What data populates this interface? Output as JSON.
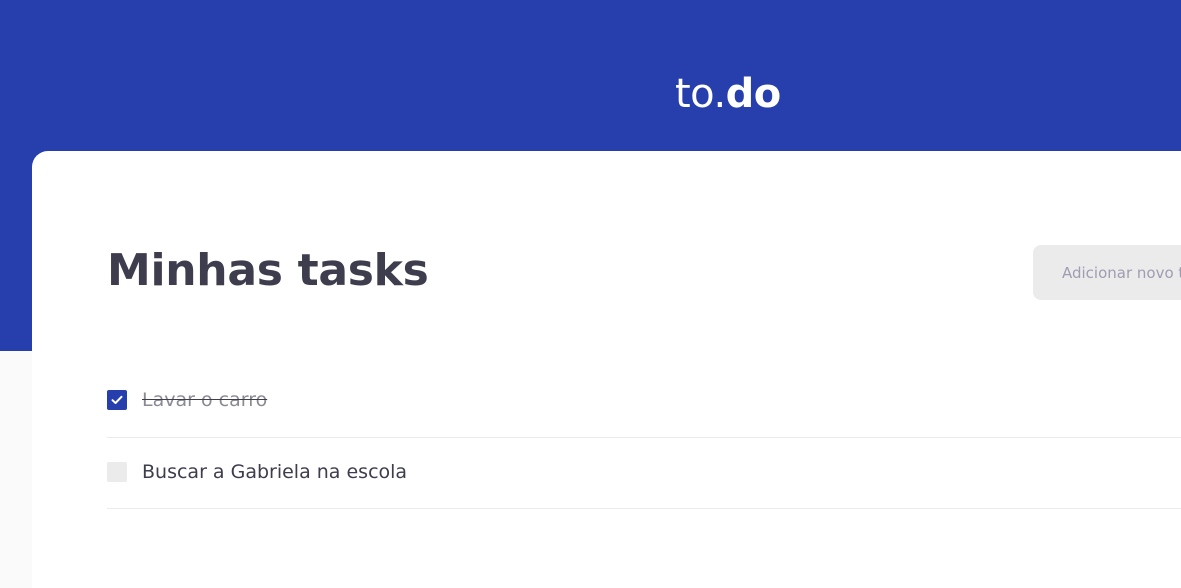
{
  "app": {
    "logo_light": "to.",
    "logo_bold": "do"
  },
  "main": {
    "title": "Minhas tasks",
    "new_task": {
      "placeholder": "Adicionar novo todo",
      "value": ""
    },
    "tasks": [
      {
        "title": "Lavar o carro",
        "completed": true
      },
      {
        "title": "Buscar a Gabriela na escola",
        "completed": false
      }
    ]
  },
  "colors": {
    "brand": "#273fad",
    "text": "#3d3d4d",
    "placeholder": "#a09cb1",
    "input_bg": "#ebebeb"
  },
  "icons": {
    "checked": "check-icon"
  }
}
